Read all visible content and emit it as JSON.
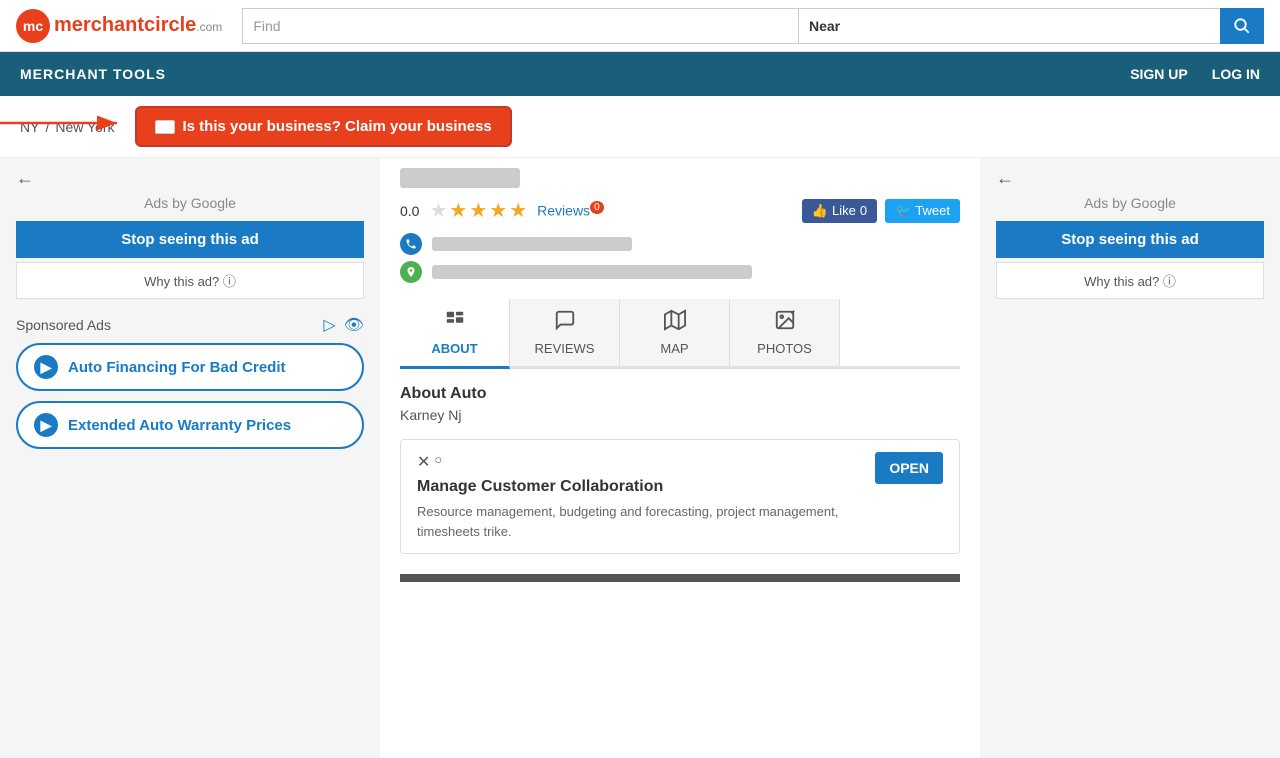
{
  "header": {
    "logo_mc": "mc",
    "logo_name": "merchant",
    "logo_domain": "circle",
    "logo_tld": ".com",
    "find_label": "Find",
    "find_placeholder": "",
    "near_label": "Near",
    "near_placeholder": "",
    "search_icon": "🔍"
  },
  "navbar": {
    "merchant_tools": "MERCHANT TOOLS",
    "signup": "SIGN UP",
    "login": "LOG IN"
  },
  "breadcrumb": {
    "state": "NY",
    "sep": "/",
    "city": "New York"
  },
  "claim": {
    "text": "Is this your business? Claim your business"
  },
  "left_ads": {
    "back_arrow": "←",
    "ads_by_google": "Ads by Google",
    "stop_seeing": "Stop seeing this ad",
    "why_this_ad": "Why this ad? ⓘ"
  },
  "right_ads": {
    "back_arrow": "←",
    "ads_by_google": "Ads by Google",
    "stop_seeing": "Stop seeing this ad",
    "why_this_ad": "Why this ad? ⓘ"
  },
  "sponsored": {
    "title": "Sponsored Ads",
    "btn1": "Auto Financing For Bad Credit",
    "btn2": "Extended Auto Warranty Prices"
  },
  "business": {
    "rating": "0.0",
    "reviews_label": "Reviews",
    "reviews_count": "0",
    "like_label": "Like",
    "like_count": "0",
    "tweet_label": "Tweet"
  },
  "tabs": {
    "about": "ABOUT",
    "reviews": "REVIEWS",
    "map": "MAP",
    "photos": "PHOTOS"
  },
  "about": {
    "title": "About Auto",
    "subtitle": "Karney Nj"
  },
  "ad_card": {
    "title": "Manage Customer Collaboration",
    "description": "Resource management, budgeting and forecasting, project management, timesheets trike.",
    "open_btn": "OPEN",
    "close_x": "✕",
    "close_circle": "○"
  }
}
